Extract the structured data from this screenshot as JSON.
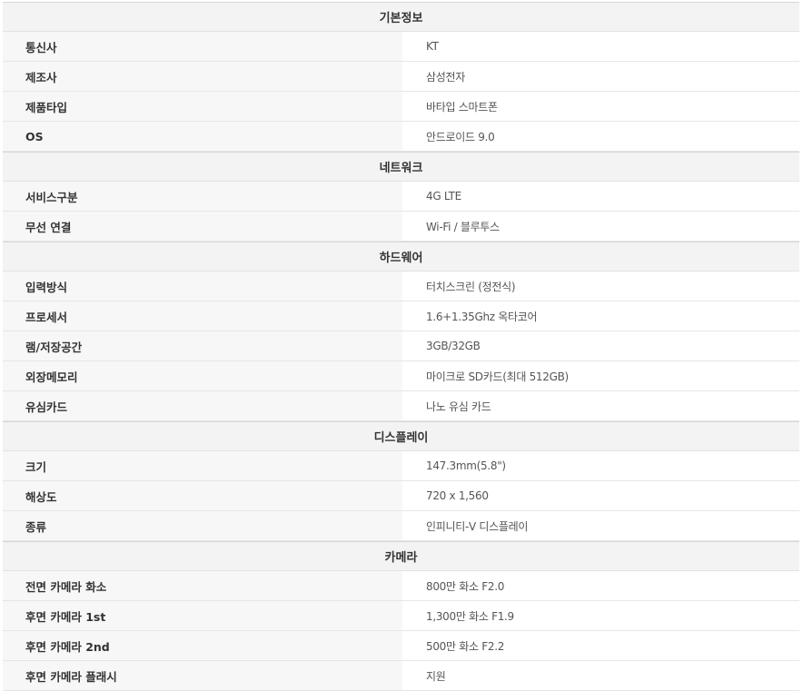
{
  "sections": [
    {
      "title": "기본정보",
      "rows": [
        {
          "label": "통신사",
          "value": "KT"
        },
        {
          "label": "제조사",
          "value": "삼성전자"
        },
        {
          "label": "제품타입",
          "value": "바타입 스마트폰"
        },
        {
          "label": "OS",
          "value": "안드로이드 9.0"
        }
      ]
    },
    {
      "title": "네트워크",
      "rows": [
        {
          "label": "서비스구분",
          "value": "4G LTE"
        },
        {
          "label": "무선 연결",
          "value": "Wi-Fi / 블루투스"
        }
      ]
    },
    {
      "title": "하드웨어",
      "rows": [
        {
          "label": "입력방식",
          "value": "터치스크린 (정전식)"
        },
        {
          "label": "프로세서",
          "value": "1.6+1.35Ghz 옥타코어"
        },
        {
          "label": "램/저장공간",
          "value": "3GB/32GB"
        },
        {
          "label": "외장메모리",
          "value": "마이크로 SD카드(최대 512GB)"
        },
        {
          "label": "유심카드",
          "value": "나노 유심 카드"
        }
      ]
    },
    {
      "title": "디스플레이",
      "rows": [
        {
          "label": "크기",
          "value": "147.3mm(5.8\")"
        },
        {
          "label": "해상도",
          "value": "720 x 1,560"
        },
        {
          "label": "종류",
          "value": "인피니티-V 디스플레이"
        }
      ]
    },
    {
      "title": "카메라",
      "rows": [
        {
          "label": "전면 카메라 화소",
          "value": "800만 화소 F2.0"
        },
        {
          "label": "후면 카메라 1st",
          "value": "1,300만 화소 F1.9"
        },
        {
          "label": "후면 카메라 2nd",
          "value": "500만 화소 F2.2"
        },
        {
          "label": "후면 카메라 플래시",
          "value": "지원"
        }
      ]
    }
  ]
}
